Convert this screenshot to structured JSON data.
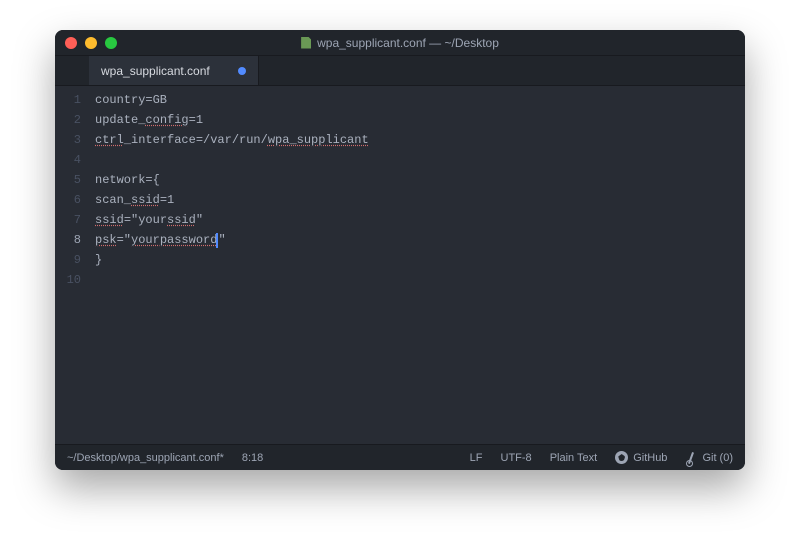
{
  "window": {
    "title": "wpa_supplicant.conf — ~/Desktop"
  },
  "tabs": [
    {
      "label": "wpa_supplicant.conf",
      "dirty": true
    }
  ],
  "editor": {
    "active_line": 8,
    "lines": [
      {
        "n": 1,
        "plain": "country=GB"
      },
      {
        "n": 2,
        "plain": "update_config=1",
        "spell": [
          "config"
        ]
      },
      {
        "n": 3,
        "plain": "ctrl_interface=/var/run/wpa_supplicant",
        "spell": [
          "ctrl",
          "wpa_supplicant"
        ]
      },
      {
        "n": 4,
        "plain": ""
      },
      {
        "n": 5,
        "plain": "network={"
      },
      {
        "n": 6,
        "plain": "scan_ssid=1",
        "spell": [
          "ssid"
        ]
      },
      {
        "n": 7,
        "plain": "ssid=\"yourssid\"",
        "spell": [
          "ssid",
          "yourssid"
        ]
      },
      {
        "n": 8,
        "plain": "psk=\"yourpassword\"",
        "spell": [
          "psk",
          "yourpassword"
        ],
        "cursor_after": "psk=\"yourpassword"
      },
      {
        "n": 9,
        "plain": "}"
      },
      {
        "n": 10,
        "plain": ""
      }
    ]
  },
  "status": {
    "filepath": "~/Desktop/wpa_supplicant.conf*",
    "cursor": "8:18",
    "line_ending": "LF",
    "encoding": "UTF-8",
    "grammar": "Plain Text",
    "github": "GitHub",
    "git": "Git (0)"
  }
}
